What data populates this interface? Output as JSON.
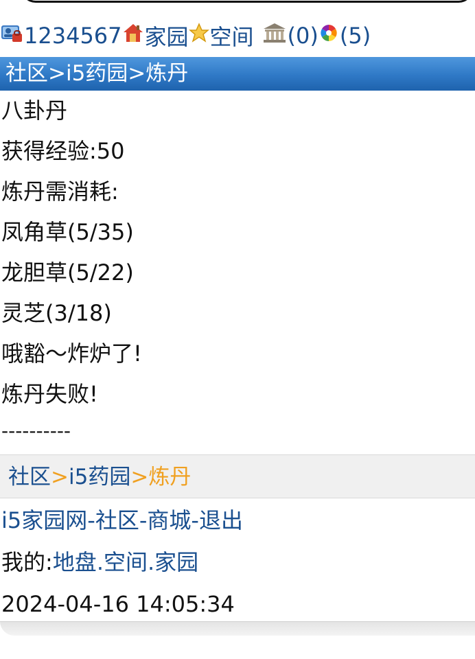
{
  "topbar": {
    "user_id": "1234567",
    "home_label": "家园",
    "space_label": "空间",
    "bank_count": "(0)",
    "message_count": "(5)"
  },
  "title_breadcrumb": "社区>i5药园>炼丹",
  "content_lines": [
    "八卦丹",
    "获得经验:50",
    "炼丹需消耗:",
    "凤角草(5/35)",
    "龙胆草(5/22)",
    "灵芝(3/18)",
    "哦豁～炸炉了!",
    "炼丹失败!",
    "----------"
  ],
  "crumb": {
    "community": "社区",
    "garden": "i5药园",
    "current": "炼丹",
    "sep": ">"
  },
  "footer": {
    "site": "i5家园网",
    "community": "社区",
    "mall": "商城",
    "logout": "退出",
    "dash": "-",
    "mine_prefix": "我的:",
    "land": "地盘",
    "space": "空间",
    "home": "家园",
    "dot": ".",
    "datetime": "2024-04-16 14:05:34"
  },
  "colors": {
    "link": "#1a4f8f",
    "title_bg": "#2f79c6",
    "crumb_highlight": "#f0a020"
  }
}
